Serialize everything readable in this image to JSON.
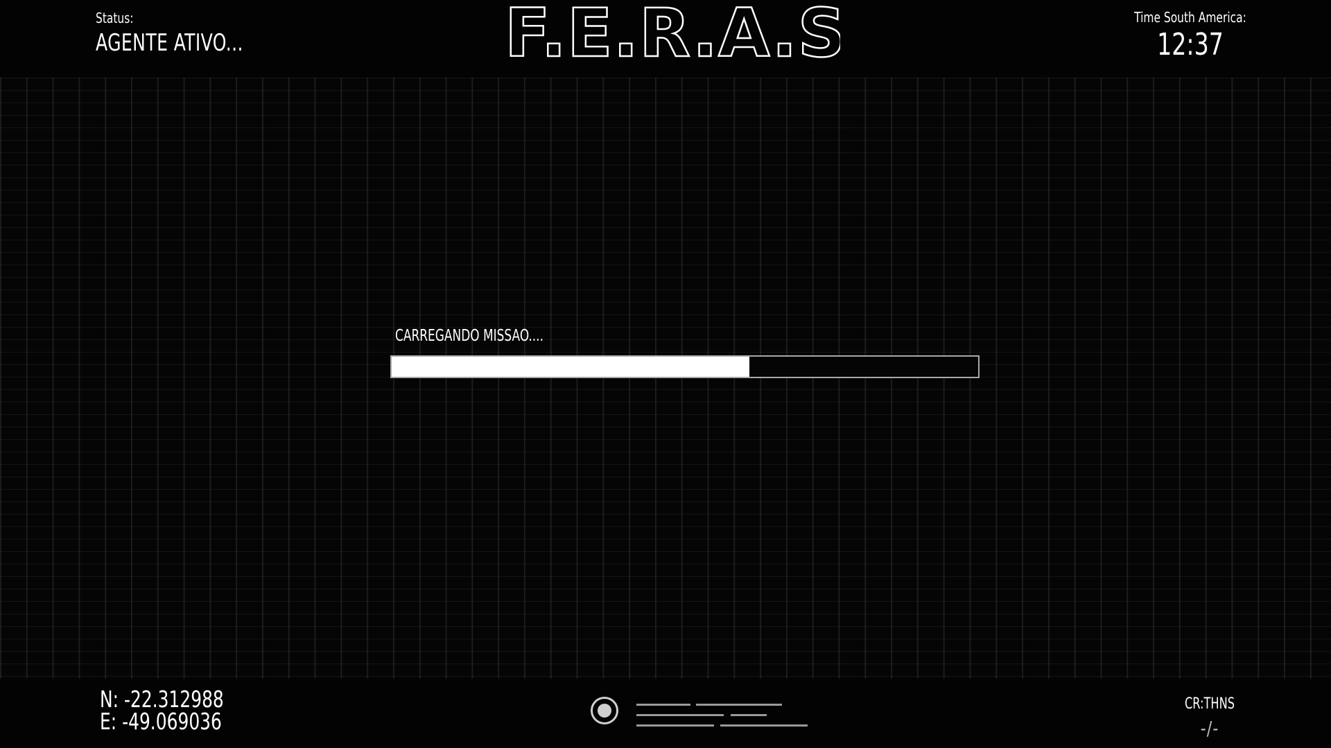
{
  "header": {
    "status_label": "Status:",
    "status_value": "AGENTE ATIVO...",
    "logo_text": "F.E.R.A.S",
    "time_label": "Time South America:",
    "time_value": "12:37"
  },
  "loading": {
    "label": "CARREGANDO MISSAO....",
    "progress_percent": 61
  },
  "footer": {
    "coordinates": {
      "north": "N: -22.312988",
      "east": "E: -49.069036"
    },
    "icon": "target-icon",
    "credit": "CR:THNS",
    "credit_mark": "-/-"
  },
  "colors": {
    "background": "#030303",
    "foreground": "#ffffff",
    "grid": "#1b1b1b",
    "progress_fill": "#ffffff",
    "progress_border": "#a8a8a8"
  }
}
